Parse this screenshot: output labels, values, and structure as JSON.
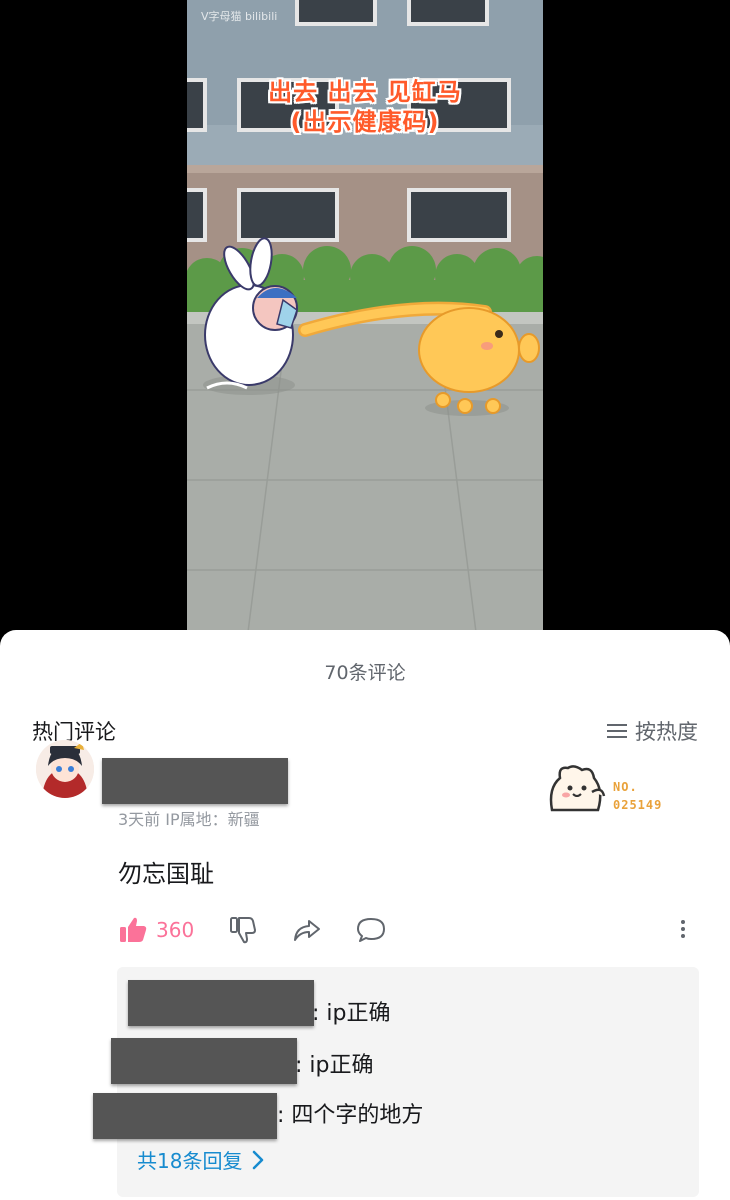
{
  "video": {
    "watermark": "V字母猫 bilibili",
    "caption_line1": "出去 出去 见缸马",
    "caption_line2": "(出示健康码)"
  },
  "comments_panel": {
    "title": "70条评论",
    "section_label": "热门评论",
    "sort_label": "按热度",
    "icons": [
      "menu-lines-icon",
      "thumb-up-icon",
      "thumb-down-icon",
      "share-icon",
      "comment-bubble-icon",
      "more-vertical-icon",
      "chevron-right-icon"
    ],
    "colors": {
      "like": "#fb7299",
      "link": "#178bcf",
      "badge": "#e9a23b",
      "muted": "#9499a0"
    }
  },
  "comment": {
    "meta": "3天前  IP属地：新疆",
    "badge_line1": "NO.",
    "badge_line2": "025149",
    "text": "勿忘国耻",
    "like_count": "360"
  },
  "replies": {
    "items": [
      {
        "text": ": ip正确"
      },
      {
        "text": ": ip正确"
      },
      {
        "text": ": 四个字的地方"
      }
    ],
    "more_label": "共18条回复"
  }
}
